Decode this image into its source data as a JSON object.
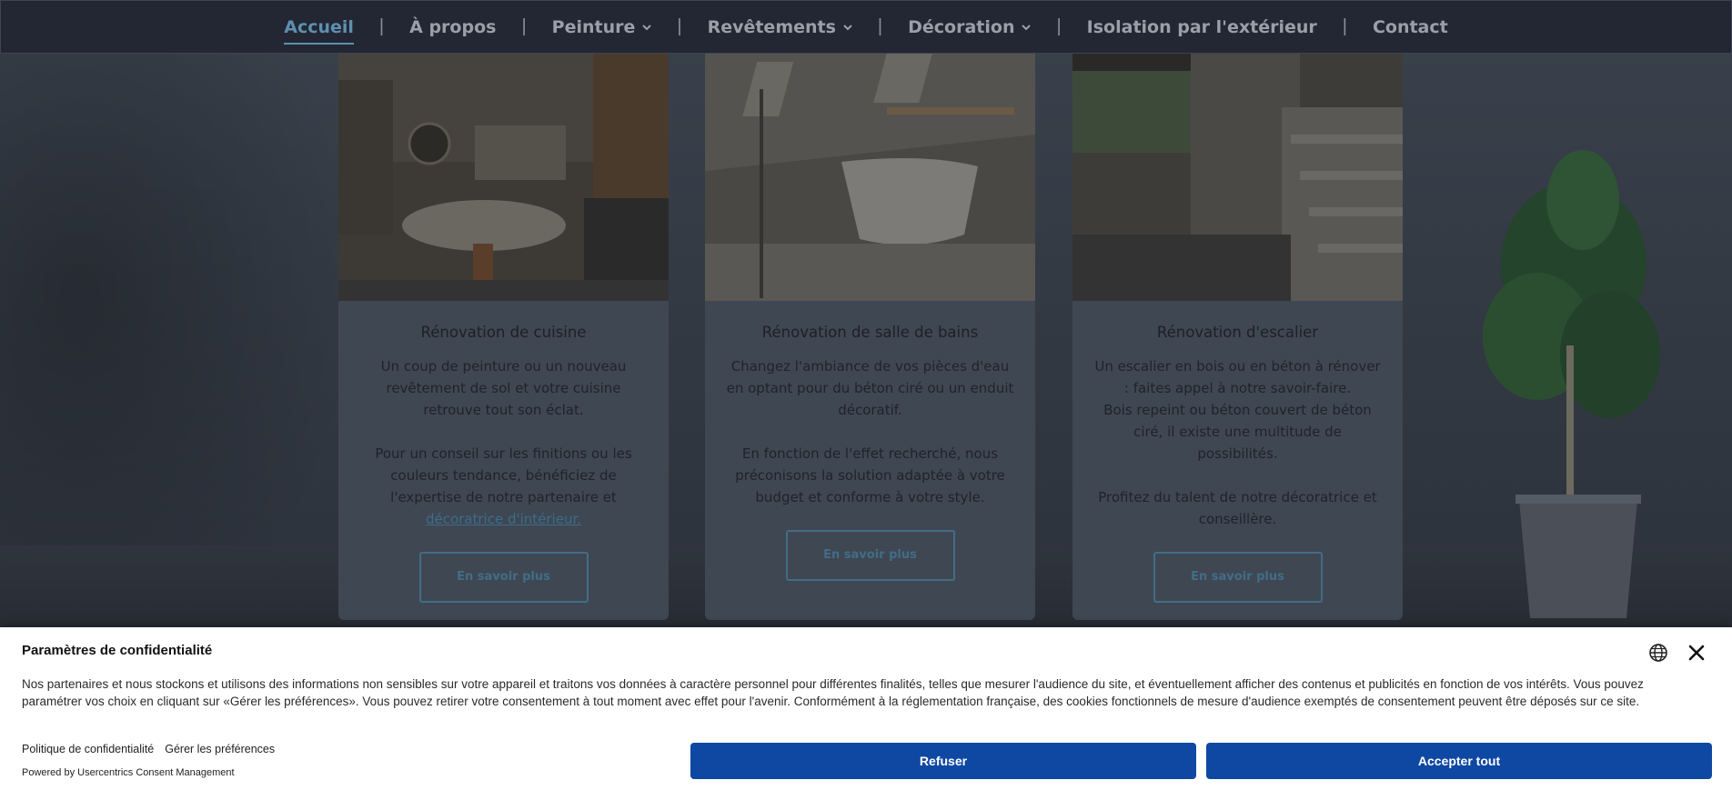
{
  "nav": {
    "items": [
      {
        "label": "Accueil",
        "active": true,
        "dropdown": false
      },
      {
        "label": "À propos",
        "active": false,
        "dropdown": false
      },
      {
        "label": "Peinture",
        "active": false,
        "dropdown": true
      },
      {
        "label": "Revêtements",
        "active": false,
        "dropdown": true
      },
      {
        "label": "Décoration",
        "active": false,
        "dropdown": true
      },
      {
        "label": "Isolation par l'extérieur",
        "active": false,
        "dropdown": false
      },
      {
        "label": "Contact",
        "active": false,
        "dropdown": false
      }
    ],
    "separator": "|",
    "active_color": "#5f8fae"
  },
  "cards": [
    {
      "title": "Rénovation de cuisine",
      "p1": "Un coup de peinture ou un nouveau revêtement de sol et votre cuisine retrouve tout son éclat.",
      "p2_before": "Pour un conseil sur les finitions ou les couleurs tendance, bénéficiez de l'expertise de notre partenaire et ",
      "p2_link": "décoratrice d'intérieur.",
      "button": "En savoir plus"
    },
    {
      "title": "Rénovation de salle de bains",
      "p1": "Changez l'ambiance de vos pièces d'eau en optant pour du béton ciré ou un enduit décoratif.",
      "p2": "En fonction de l'effet recherché, nous préconisons la solution adaptée à votre budget et conforme à votre style.",
      "button": "En savoir plus"
    },
    {
      "title": "Rénovation d'escalier",
      "p1a": "Un escalier en bois ou en béton à rénover : faites appel à notre savoir-faire.",
      "p1b": "Bois repeint ou béton couvert de béton ciré, il existe une multitude de possibilités.",
      "p2": "Profitez du talent de notre décoratrice et conseillère.",
      "button": "En savoir plus"
    }
  ],
  "consent": {
    "title": "Paramètres de confidentialité",
    "description": "Nos partenaires et nous stockons et utilisons des informations non sensibles sur votre appareil et traitons vos données à caractère personnel pour différentes finalités, telles que mesurer l'audience du site, et éventuellement afficher des contenus et publicités en fonction de vos intérêts. Vous pouvez paramétrer vos choix en cliquant sur «Gérer les préférences». Vous pouvez retirer votre consentement à tout moment avec effet pour l'avenir. Conformément à la réglementation française, des cookies fonctionnels de mesure d'audience exemptés de consentement peuvent être déposés sur ce site.",
    "privacy_link": "Politique de confidentialité",
    "prefs_link": "Gérer les préférences",
    "powered_by": "Powered by Usercentrics Consent Management",
    "refuse": "Refuser",
    "accept": "Accepter tout",
    "button_color": "#0f48a3",
    "icons": {
      "language": "globe-icon",
      "close": "close-icon"
    }
  }
}
